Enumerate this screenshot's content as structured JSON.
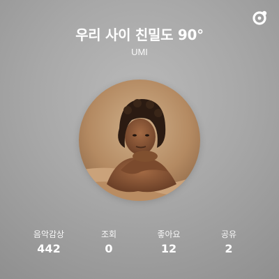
{
  "song": {
    "title": "우리 사이 친밀도 90°",
    "artist": "UMI"
  },
  "logo_icon": "music-app-logo-icon",
  "cover_icon": "album-cover-portrait",
  "stats": [
    {
      "label": "음악감상",
      "value": "442"
    },
    {
      "label": "조회",
      "value": "0"
    },
    {
      "label": "좋아요",
      "value": "12"
    },
    {
      "label": "공유",
      "value": "2"
    }
  ]
}
